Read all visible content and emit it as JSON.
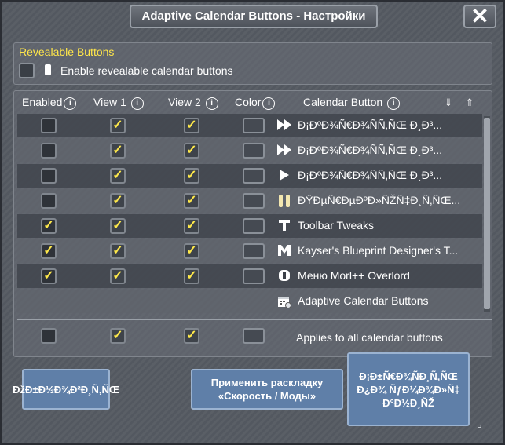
{
  "window": {
    "title": "Adaptive Calendar Buttons - Настройки",
    "close_symbol": "✕"
  },
  "revealable": {
    "title": "Revealable Buttons",
    "label": "Enable revealable calendar buttons",
    "checked": false
  },
  "columns": {
    "enabled": "Enabled",
    "view1": "View 1",
    "view2": "View 2",
    "color": "Color",
    "calendar_button": "Calendar Button",
    "info_symbol": "i",
    "sort_down_symbol": "⇓",
    "sort_up_symbol": "⇑"
  },
  "rows": [
    {
      "icon": "fast-forward-icon",
      "name": "Ð¡ÐºÐ¾Ñ€Ð¾ÑÑ‚ÑŒ Ð¸Ð³...",
      "enabled": false,
      "view1": true,
      "view2": true
    },
    {
      "icon": "fast-forward-icon",
      "name": "Ð¡ÐºÐ¾Ñ€Ð¾ÑÑ‚ÑŒ Ð¸Ð³...",
      "enabled": false,
      "view1": true,
      "view2": true
    },
    {
      "icon": "play-icon",
      "name": "Ð¡ÐºÐ¾Ñ€Ð¾ÑÑ‚ÑŒ Ð¸Ð³...",
      "enabled": false,
      "view1": true,
      "view2": true
    },
    {
      "icon": "pause-icon",
      "name": "ÐŸÐµÑ€ÐµÐºÐ»ÑŽÑ‡Ð¸Ñ‚ÑŒ...",
      "enabled": false,
      "view1": true,
      "view2": true
    },
    {
      "icon": "toolbar-tweaks-icon",
      "name": "Toolbar Tweaks",
      "enabled": true,
      "view1": true,
      "view2": true
    },
    {
      "icon": "kayser-m-icon",
      "name": "Kayser's Blueprint Designer's T...",
      "enabled": true,
      "view1": true,
      "view2": true
    },
    {
      "icon": "menu-overlord-icon",
      "name": "Меню Morl++ Overlord",
      "enabled": true,
      "view1": true,
      "view2": true
    },
    {
      "icon": "calendar-settings-icon",
      "name": "Adaptive Calendar Buttons",
      "fixed": true
    }
  ],
  "applies_all": {
    "label": "Applies to all calendar buttons",
    "enabled": false,
    "view1": true,
    "view2": true
  },
  "check_symbol": "✓",
  "buttons": {
    "left": "ÐžÐ±Ð½Ð¾Ð²Ð¸Ñ‚ÑŒ",
    "middle_line1": "Применить раскладку",
    "middle_line2": "«Скорость / Моды»",
    "right": "Ð¡Ð±Ñ€Ð¾ÑÐ¸Ñ‚ÑŒ Ð¿Ð¾ ÑƒÐ¼Ð¾Ð»Ñ‡Ð°Ð½Ð¸ÑŽ"
  },
  "colors": {
    "accent_yellow": "#ffe64a",
    "button_blue": "#5f7fa8"
  }
}
